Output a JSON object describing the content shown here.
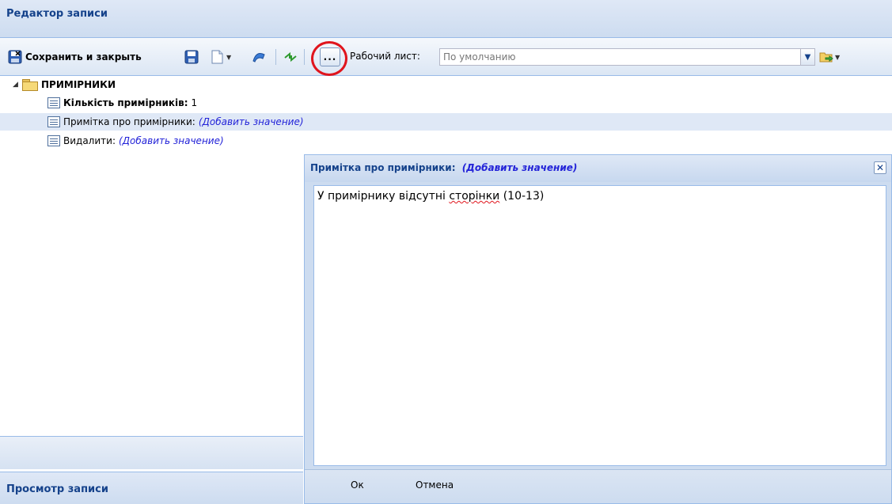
{
  "panel": {
    "title": "Редактор записи"
  },
  "toolbar": {
    "save_close_label": "Сохранить и закрыть",
    "more_label": "...",
    "worksheet_label": "Рабочий лист:",
    "worksheet_value": "По умолчанию"
  },
  "tree": {
    "root_label": "ПРИМІРНИКИ",
    "rows": [
      {
        "label": "Кількість примірників:",
        "value": "1"
      },
      {
        "label": "Примітка про примірники:",
        "value": "(Добавить значение)"
      },
      {
        "label": "Видалити:",
        "value": "(Добавить значение)"
      }
    ]
  },
  "bottom_panel": {
    "title": "Просмотр записи"
  },
  "popup": {
    "title": "Примітка про примірники:",
    "title_value": "(Добавить значение)",
    "text_before": "У примірнику відсутні ",
    "text_misspelled": "сторінки",
    "text_after": " (10-13)",
    "ok_label": "Ок",
    "cancel_label": "Отмена"
  },
  "colors": {
    "header_text": "#15428b",
    "link": "#2323d8",
    "highlight": "#e0151d"
  }
}
